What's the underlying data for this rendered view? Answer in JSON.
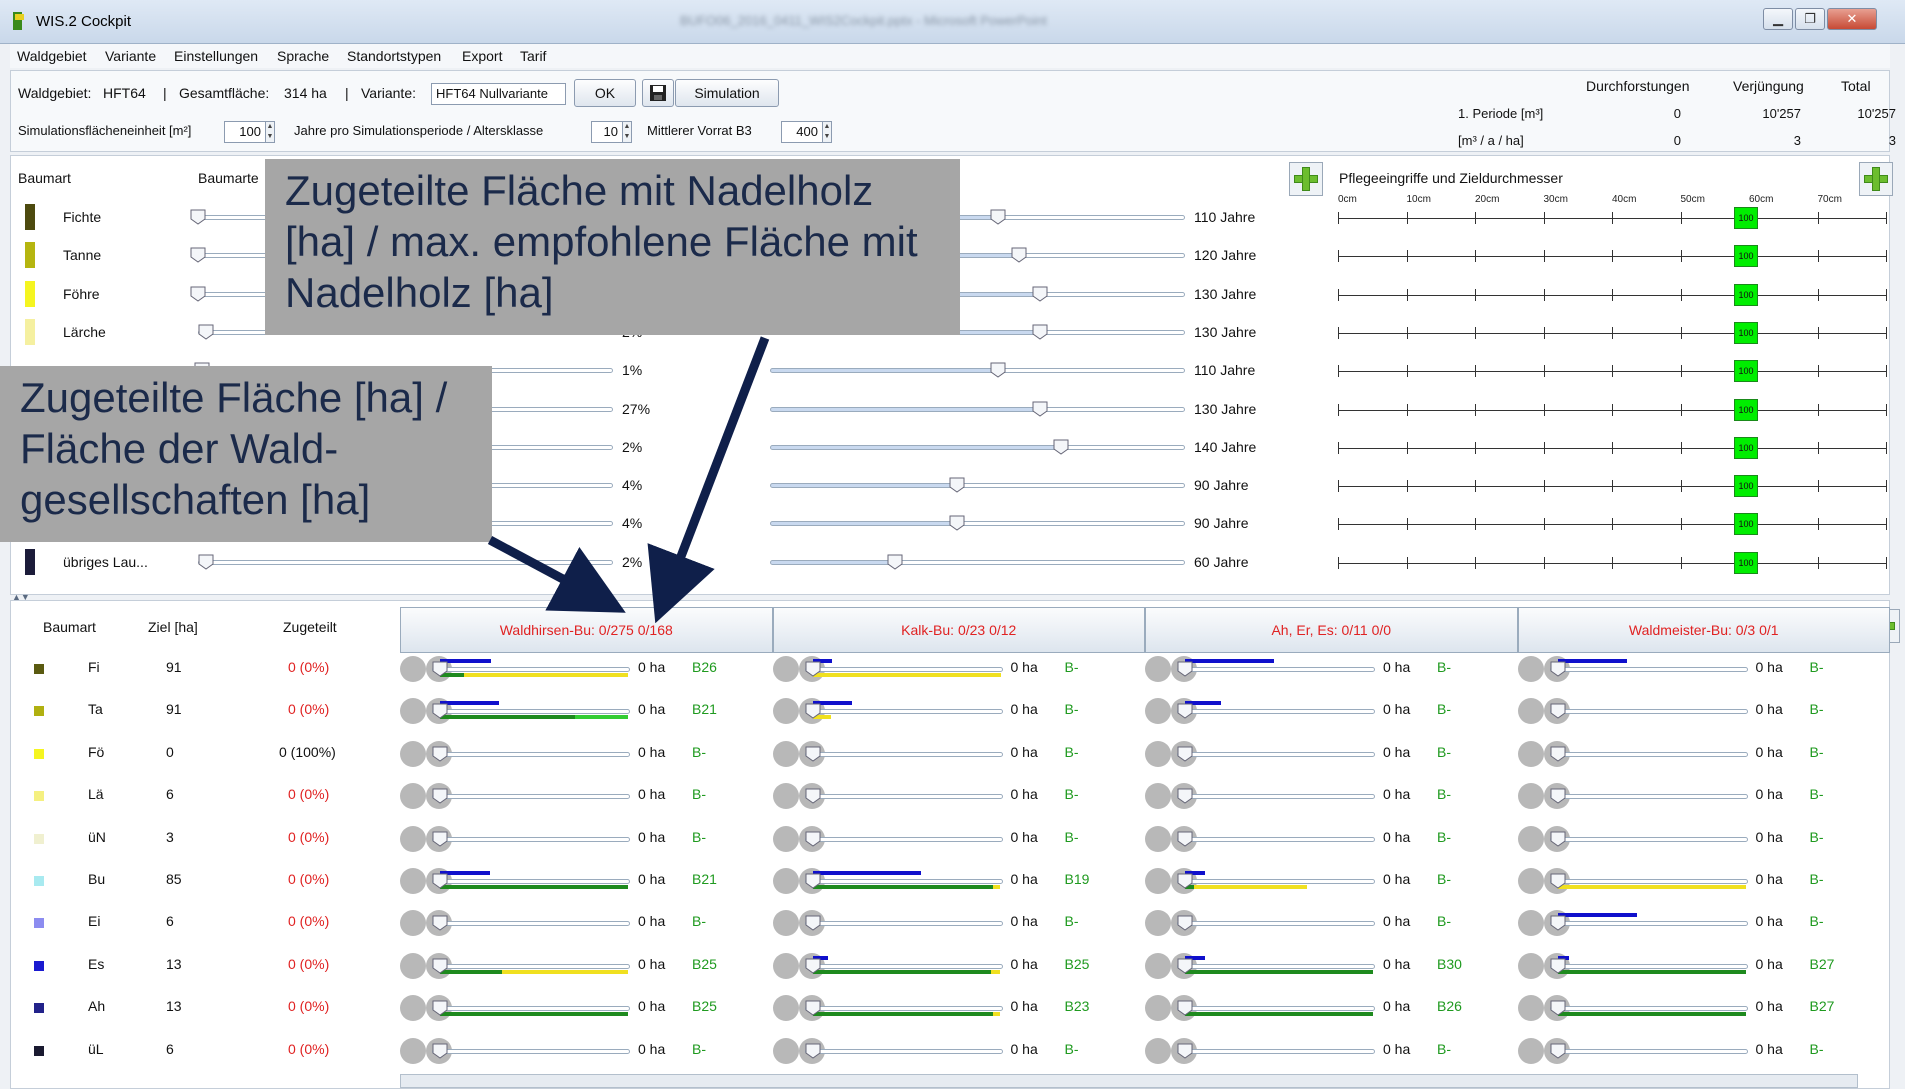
{
  "window": {
    "title": "WIS.2 Cockpit",
    "background_title": "BUFO06_2016_0411_WIS2Cockpit.pptx - Microsoft PowerPoint",
    "controls": [
      "▁",
      "❐",
      "✕"
    ]
  },
  "menu": [
    "Waldgebiet",
    "Variante",
    "Einstellungen",
    "Sprache",
    "Standortstypen",
    "Export",
    "Tarif"
  ],
  "info": {
    "waldgebiet_label": "Waldgebiet:",
    "waldgebiet_value": "HFT64",
    "sep1": "|",
    "gesamtflaeche_label": "Gesamtfläche:",
    "gesamtflaeche_value": "314 ha",
    "sep2": "|",
    "variante_label": "Variante:",
    "variante_value": "HFT64 Nullvariante",
    "ok_label": "OK",
    "simulation_label": "Simulation",
    "sfe_label": "Simulationsflächeneinheit [m²]",
    "sfe_value": "100",
    "jahre_label": "Jahre pro Simulationsperiode / Altersklasse",
    "jahre_value": "10",
    "vorrat_label": "Mittlerer Vorrat B3",
    "vorrat_value": "400"
  },
  "summary": {
    "headers": [
      "Durchforstungen",
      "Verjüngung",
      "Total"
    ],
    "rows": [
      {
        "label": "1. Periode [m³]",
        "values": [
          "0",
          "10'257",
          "10'257"
        ]
      },
      {
        "label": "[m³ / a / ha]",
        "values": [
          "0",
          "3",
          "3"
        ]
      }
    ]
  },
  "upper": {
    "baumart_header": "Baumart",
    "baumarten_header": "Baumarte",
    "pflege_header": "Pflegeeingriffe und Zieldurchmesser",
    "scale": [
      "0cm",
      "10cm",
      "20cm",
      "30cm",
      "40cm",
      "50cm",
      "60cm",
      "70cm"
    ],
    "rows": [
      {
        "name": "Fichte",
        "color": "#4d4a0f",
        "pct": "",
        "years": "110 Jahre",
        "umtrieb": 0.55,
        "dist": 0.0,
        "zd": "100"
      },
      {
        "name": "Tanne",
        "color": "#b5b510",
        "pct": "",
        "years": "120 Jahre",
        "umtrieb": 0.6,
        "dist": 0.0,
        "zd": "100"
      },
      {
        "name": "Föhre",
        "color": "#f5f520",
        "pct": "",
        "years": "130 Jahre",
        "umtrieb": 0.65,
        "dist": 0.0,
        "zd": "100"
      },
      {
        "name": "Lärche",
        "color": "#f5f0a0",
        "pct": "2%",
        "years": "130 Jahre",
        "umtrieb": 0.65,
        "dist": 0.02,
        "zd": "100"
      },
      {
        "name": "",
        "color": "",
        "pct": "1%",
        "years": "110 Jahre",
        "umtrieb": 0.55,
        "dist": 0.01,
        "zd": "100"
      },
      {
        "name": "",
        "color": "",
        "pct": "27%",
        "years": "130 Jahre",
        "umtrieb": 0.65,
        "dist": 0.27,
        "zd": "100"
      },
      {
        "name": "",
        "color": "",
        "pct": "2%",
        "years": "140 Jahre",
        "umtrieb": 0.7,
        "dist": 0.02,
        "zd": "100"
      },
      {
        "name": "",
        "color": "",
        "pct": "4%",
        "years": "90 Jahre",
        "umtrieb": 0.45,
        "dist": 0.04,
        "zd": "100"
      },
      {
        "name": "",
        "color": "",
        "pct": "4%",
        "years": "90 Jahre",
        "umtrieb": 0.45,
        "dist": 0.04,
        "zd": "100"
      },
      {
        "name": "übriges Lau...",
        "color": "#1c1c3a",
        "pct": "2%",
        "years": "60 Jahre",
        "umtrieb": 0.3,
        "dist": 0.02,
        "zd": "100"
      }
    ]
  },
  "lower": {
    "headers": {
      "baumart": "Baumart",
      "ziel": "Ziel [ha]",
      "zugeteilt": "Zugeteilt"
    },
    "columns": [
      "Waldhirsen-Bu: 0/275  0/168",
      "Kalk-Bu: 0/23  0/12",
      "Ah, Er, Es: 0/11  0/0",
      "Waldmeister-Bu: 0/3  0/1"
    ],
    "rows": [
      {
        "code": "Fi",
        "color": "#5a5a10",
        "ziel": "91",
        "zug": "0 (0%)",
        "zug_red": true,
        "cells": [
          {
            "ha": "0 ha",
            "b": "B26",
            "blue": 0.26,
            "lower": [
              [
                "#1e8a1e",
                0.13
              ],
              [
                "#f0e020",
                0.87
              ]
            ]
          },
          {
            "ha": "0 ha",
            "b": "B-",
            "blue": 0.1,
            "lower": [
              [
                "#f0e020",
                1.0
              ]
            ]
          },
          {
            "ha": "0 ha",
            "b": "B-",
            "blue": 0.45,
            "lower": []
          },
          {
            "ha": "0 ha",
            "b": "B-",
            "blue": 0.35,
            "lower": []
          }
        ]
      },
      {
        "code": "Ta",
        "color": "#b0b010",
        "ziel": "91",
        "zug": "0 (0%)",
        "zug_red": true,
        "cells": [
          {
            "ha": "0 ha",
            "b": "B21",
            "blue": 0.3,
            "lower": [
              [
                "#1e8a1e",
                0.72
              ],
              [
                "#33cc33",
                0.28
              ]
            ]
          },
          {
            "ha": "0 ha",
            "b": "B-",
            "blue": 0.2,
            "lower": [
              [
                "#f0e020",
                0.1
              ]
            ]
          },
          {
            "ha": "0 ha",
            "b": "B-",
            "blue": 0.18,
            "lower": []
          },
          {
            "ha": "0 ha",
            "b": "B-",
            "blue": 0.0,
            "lower": []
          }
        ]
      },
      {
        "code": "Fö",
        "color": "#f5f520",
        "ziel": "0",
        "zug": "0 (100%)",
        "zug_red": false,
        "cells": [
          {
            "ha": "0 ha",
            "b": "B-",
            "blue": 0,
            "lower": []
          },
          {
            "ha": "0 ha",
            "b": "B-",
            "blue": 0,
            "lower": []
          },
          {
            "ha": "0 ha",
            "b": "B-",
            "blue": 0,
            "lower": []
          },
          {
            "ha": "0 ha",
            "b": "B-",
            "blue": 0,
            "lower": []
          }
        ]
      },
      {
        "code": "Lä",
        "color": "#f5f080",
        "ziel": "6",
        "zug": "0 (0%)",
        "zug_red": true,
        "cells": [
          {
            "ha": "0 ha",
            "b": "B-",
            "blue": 0,
            "lower": []
          },
          {
            "ha": "0 ha",
            "b": "B-",
            "blue": 0,
            "lower": []
          },
          {
            "ha": "0 ha",
            "b": "B-",
            "blue": 0,
            "lower": []
          },
          {
            "ha": "0 ha",
            "b": "B-",
            "blue": 0,
            "lower": []
          }
        ]
      },
      {
        "code": "üN",
        "color": "#f0f0d0",
        "ziel": "3",
        "zug": "0 (0%)",
        "zug_red": true,
        "cells": [
          {
            "ha": "0 ha",
            "b": "B-",
            "blue": 0,
            "lower": []
          },
          {
            "ha": "0 ha",
            "b": "B-",
            "blue": 0,
            "lower": []
          },
          {
            "ha": "0 ha",
            "b": "B-",
            "blue": 0,
            "lower": []
          },
          {
            "ha": "0 ha",
            "b": "B-",
            "blue": 0,
            "lower": []
          }
        ]
      },
      {
        "code": "Bu",
        "color": "#a8eaf0",
        "ziel": "85",
        "zug": "0 (0%)",
        "zug_red": true,
        "cells": [
          {
            "ha": "0 ha",
            "b": "B21",
            "blue": 0.25,
            "lower": [
              [
                "#1e8a1e",
                1.0
              ]
            ]
          },
          {
            "ha": "0 ha",
            "b": "B19",
            "blue": 0.55,
            "lower": [
              [
                "#1e8a1e",
                0.96
              ],
              [
                "#f0e020",
                0.04
              ]
            ]
          },
          {
            "ha": "0 ha",
            "b": "B-",
            "blue": 0.1,
            "lower": [
              [
                "#1e8a1e",
                0.05
              ],
              [
                "#f0e020",
                0.6
              ]
            ]
          },
          {
            "ha": "0 ha",
            "b": "B-",
            "blue": 0.0,
            "lower": [
              [
                "#f0e020",
                1.0
              ]
            ]
          }
        ]
      },
      {
        "code": "Ei",
        "color": "#8c8cf0",
        "ziel": "6",
        "zug": "0 (0%)",
        "zug_red": true,
        "cells": [
          {
            "ha": "0 ha",
            "b": "B-",
            "blue": 0,
            "lower": []
          },
          {
            "ha": "0 ha",
            "b": "B-",
            "blue": 0,
            "lower": []
          },
          {
            "ha": "0 ha",
            "b": "B-",
            "blue": 0,
            "lower": []
          },
          {
            "ha": "0 ha",
            "b": "B-",
            "blue": 0.4,
            "lower": []
          }
        ]
      },
      {
        "code": "Es",
        "color": "#1a1ad0",
        "ziel": "13",
        "zug": "0 (0%)",
        "zug_red": true,
        "cells": [
          {
            "ha": "0 ha",
            "b": "B25",
            "blue": 0.0,
            "lower": [
              [
                "#1e8a1e",
                0.33
              ],
              [
                "#f0e020",
                0.67
              ]
            ]
          },
          {
            "ha": "0 ha",
            "b": "B25",
            "blue": 0.08,
            "lower": [
              [
                "#1e8a1e",
                0.95
              ],
              [
                "#f0e020",
                0.05
              ]
            ]
          },
          {
            "ha": "0 ha",
            "b": "B30",
            "blue": 0.1,
            "lower": [
              [
                "#1e8a1e",
                1.0
              ]
            ]
          },
          {
            "ha": "0 ha",
            "b": "B27",
            "blue": 0.06,
            "lower": [
              [
                "#1e8a1e",
                1.0
              ]
            ]
          }
        ]
      },
      {
        "code": "Ah",
        "color": "#22228a",
        "ziel": "13",
        "zug": "0 (0%)",
        "zug_red": true,
        "cells": [
          {
            "ha": "0 ha",
            "b": "B25",
            "blue": 0,
            "lower": [
              [
                "#1e8a1e",
                1.0
              ]
            ]
          },
          {
            "ha": "0 ha",
            "b": "B23",
            "blue": 0,
            "lower": [
              [
                "#1e8a1e",
                0.96
              ],
              [
                "#f0e020",
                0.04
              ]
            ]
          },
          {
            "ha": "0 ha",
            "b": "B26",
            "blue": 0,
            "lower": [
              [
                "#1e8a1e",
                1.0
              ]
            ]
          },
          {
            "ha": "0 ha",
            "b": "B27",
            "blue": 0,
            "lower": [
              [
                "#1e8a1e",
                1.0
              ]
            ]
          }
        ]
      },
      {
        "code": "üL",
        "color": "#1a1a30",
        "ziel": "6",
        "zug": "0 (0%)",
        "zug_red": true,
        "cells": [
          {
            "ha": "0 ha",
            "b": "B-",
            "blue": 0,
            "lower": []
          },
          {
            "ha": "0 ha",
            "b": "B-",
            "blue": 0,
            "lower": []
          },
          {
            "ha": "0 ha",
            "b": "B-",
            "blue": 0,
            "lower": []
          },
          {
            "ha": "0 ha",
            "b": "B-",
            "blue": 0,
            "lower": []
          }
        ]
      }
    ]
  },
  "callouts": {
    "nadelholz": "Zugeteilte Fläche mit Nadelholz [ha] / max. empfohlene Fläche mit Nadelholz [ha]",
    "zugeteilt": "Zugeteilte Fläche [ha] / Fläche der Wald-gesellschaften [ha]"
  },
  "colors": {
    "accent_red": "#e02222",
    "code_green": "#1f9a1f",
    "blue_bar": "#1010cc",
    "arrow": "#0f1f4a"
  }
}
